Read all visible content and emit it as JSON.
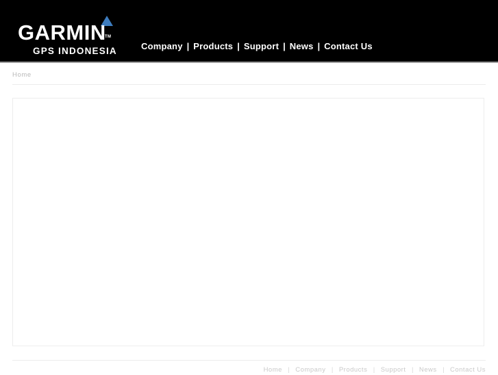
{
  "header": {
    "background_color": "#000000",
    "logo": {
      "wordmark": "GARMIN",
      "trademark": "TM",
      "subtitle": "GPS INDONESIA",
      "triangle_color": "#3d7cbe",
      "triangle_icon_name": "garmin-triangle-icon"
    },
    "nav": {
      "separator": "|",
      "items": [
        {
          "label": "Company"
        },
        {
          "label": "Products"
        },
        {
          "label": "Support"
        },
        {
          "label": "News"
        },
        {
          "label": "Contact Us"
        }
      ]
    }
  },
  "breadcrumb": {
    "items": [
      {
        "label": "Home"
      }
    ]
  },
  "main": {
    "content": ""
  },
  "footer": {
    "separator": "|",
    "items": [
      {
        "label": "Home"
      },
      {
        "label": "Company"
      },
      {
        "label": "Products"
      },
      {
        "label": "Support"
      },
      {
        "label": "News"
      },
      {
        "label": "Contact Us"
      }
    ]
  }
}
